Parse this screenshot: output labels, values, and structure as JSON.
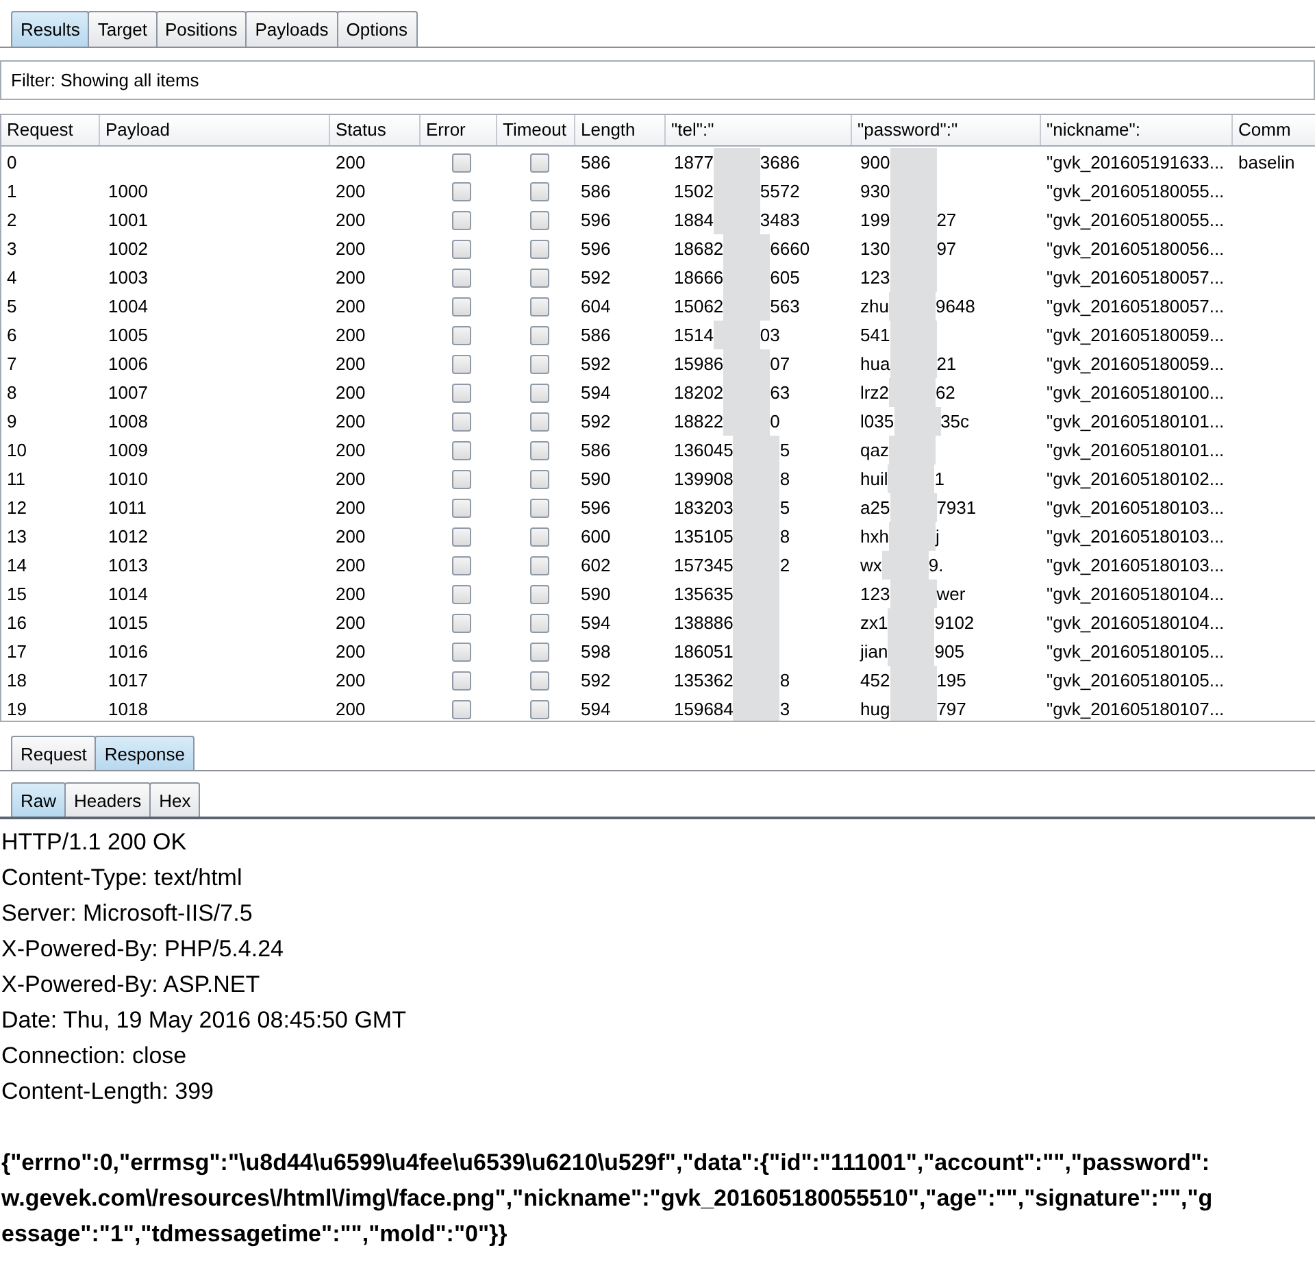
{
  "tabs": [
    {
      "label": "Results",
      "selected": true
    },
    {
      "label": "Target",
      "selected": false
    },
    {
      "label": "Positions",
      "selected": false
    },
    {
      "label": "Payloads",
      "selected": false
    },
    {
      "label": "Options",
      "selected": false
    }
  ],
  "filter": "Filter: Showing all items",
  "table": {
    "columns": [
      "Request",
      "Payload",
      "Status",
      "Error",
      "Timeout",
      "Length",
      "\"tel\":\"",
      "\"password\":\"",
      "\"nickname\":",
      "Comm"
    ],
    "rows": [
      {
        "request": "0",
        "status": "200",
        "error": false,
        "timeout": false,
        "length": "586",
        "tel": {
          "start": "1877",
          "end": "3686"
        },
        "password": {
          "start": "900"
        },
        "nickname": "\"gvk_201605191633...",
        "comment": "baselin"
      },
      {
        "request": "1",
        "payload": "1000",
        "status": "200",
        "error": false,
        "timeout": false,
        "length": "586",
        "tel": {
          "start": "1502",
          "end": "5572"
        },
        "password": {
          "start": "930"
        },
        "nickname": "\"gvk_201605180055..."
      },
      {
        "request": "2",
        "payload": "1001",
        "status": "200",
        "error": false,
        "timeout": false,
        "length": "596",
        "tel": {
          "start": "1884",
          "end": "3483"
        },
        "password": {
          "start": "199",
          "end": "27"
        },
        "nickname": "\"gvk_201605180055..."
      },
      {
        "request": "3",
        "payload": "1002",
        "status": "200",
        "error": false,
        "timeout": false,
        "length": "596",
        "tel": {
          "start": "18682",
          "end": "6660"
        },
        "password": {
          "start": "130",
          "end": "97"
        },
        "nickname": "\"gvk_201605180056..."
      },
      {
        "request": "4",
        "payload": "1003",
        "status": "200",
        "error": false,
        "timeout": false,
        "length": "592",
        "tel": {
          "start": "18666",
          "end": "605"
        },
        "password": {
          "start": "123"
        },
        "nickname": "\"gvk_201605180057..."
      },
      {
        "request": "5",
        "payload": "1004",
        "status": "200",
        "error": false,
        "timeout": false,
        "length": "604",
        "tel": {
          "start": "15062",
          "end": "563"
        },
        "password": {
          "start": "zhu",
          "end": "9648"
        },
        "nickname": "\"gvk_201605180057..."
      },
      {
        "request": "6",
        "payload": "1005",
        "status": "200",
        "error": false,
        "timeout": false,
        "length": "586",
        "tel": {
          "start": "1514",
          "end": "03"
        },
        "password": {
          "start": "541"
        },
        "nickname": "\"gvk_201605180059..."
      },
      {
        "request": "7",
        "payload": "1006",
        "status": "200",
        "error": false,
        "timeout": false,
        "length": "592",
        "tel": {
          "start": "15986",
          "end": "07"
        },
        "password": {
          "start": "hua",
          "end": "21"
        },
        "nickname": "\"gvk_201605180059..."
      },
      {
        "request": "8",
        "payload": "1007",
        "status": "200",
        "error": false,
        "timeout": false,
        "length": "594",
        "tel": {
          "start": "18202",
          "end": "63"
        },
        "password": {
          "start": "lrz2",
          "end": "62"
        },
        "nickname": "\"gvk_201605180100..."
      },
      {
        "request": "9",
        "payload": "1008",
        "status": "200",
        "error": false,
        "timeout": false,
        "length": "592",
        "tel": {
          "start": "18822",
          "end": "0"
        },
        "password": {
          "start": "l035",
          "end": "35c"
        },
        "nickname": "\"gvk_201605180101..."
      },
      {
        "request": "10",
        "payload": "1009",
        "status": "200",
        "error": false,
        "timeout": false,
        "length": "586",
        "tel": {
          "start": "136045",
          "end": "5"
        },
        "password": {
          "start": "qaz"
        },
        "nickname": "\"gvk_201605180101..."
      },
      {
        "request": "11",
        "payload": "1010",
        "status": "200",
        "error": false,
        "timeout": false,
        "length": "590",
        "tel": {
          "start": "139908",
          "end": "8"
        },
        "password": {
          "start": "huil",
          "end": "1"
        },
        "nickname": "\"gvk_201605180102..."
      },
      {
        "request": "12",
        "payload": "1011",
        "status": "200",
        "error": false,
        "timeout": false,
        "length": "596",
        "tel": {
          "start": "183203",
          "end": "5"
        },
        "password": {
          "start": "a25",
          "end": "7931"
        },
        "nickname": "\"gvk_201605180103..."
      },
      {
        "request": "13",
        "payload": "1012",
        "status": "200",
        "error": false,
        "timeout": false,
        "length": "600",
        "tel": {
          "start": "135105",
          "end": "8"
        },
        "password": {
          "start": "hxh",
          "end": "j"
        },
        "nickname": "\"gvk_201605180103..."
      },
      {
        "request": "14",
        "payload": "1013",
        "status": "200",
        "error": false,
        "timeout": false,
        "length": "602",
        "tel": {
          "start": "157345",
          "end": "2"
        },
        "password": {
          "start": "wx",
          "end": "9."
        },
        "nickname": "\"gvk_201605180103..."
      },
      {
        "request": "15",
        "payload": "1014",
        "status": "200",
        "error": false,
        "timeout": false,
        "length": "590",
        "tel": {
          "start": "135635"
        },
        "password": {
          "start": "123",
          "end": "wer"
        },
        "nickname": "\"gvk_201605180104..."
      },
      {
        "request": "16",
        "payload": "1015",
        "status": "200",
        "error": false,
        "timeout": false,
        "length": "594",
        "tel": {
          "start": "138886"
        },
        "password": {
          "start": "zx1",
          "end": "9102"
        },
        "nickname": "\"gvk_201605180104..."
      },
      {
        "request": "17",
        "payload": "1016",
        "status": "200",
        "error": false,
        "timeout": false,
        "length": "598",
        "tel": {
          "start": "186051"
        },
        "password": {
          "start": "jian",
          "end": "905"
        },
        "nickname": "\"gvk_201605180105..."
      },
      {
        "request": "18",
        "payload": "1017",
        "status": "200",
        "error": false,
        "timeout": false,
        "length": "592",
        "tel": {
          "start": "135362",
          "end": "8"
        },
        "password": {
          "start": "452",
          "end": "195"
        },
        "nickname": "\"gvk_201605180105..."
      },
      {
        "request": "19",
        "payload": "1018",
        "status": "200",
        "error": false,
        "timeout": false,
        "length": "594",
        "tel": {
          "start": "159684",
          "end": "3"
        },
        "password": {
          "start": "hug",
          "end": "797"
        },
        "nickname": "\"gvk_201605180107..."
      }
    ]
  },
  "message_tabs": [
    {
      "label": "Request",
      "selected": false
    },
    {
      "label": "Response",
      "selected": true
    }
  ],
  "view_tabs": [
    {
      "label": "Raw",
      "selected": true
    },
    {
      "label": "Headers",
      "selected": false
    },
    {
      "label": "Hex",
      "selected": false
    }
  ],
  "response_lines": [
    "HTTP/1.1 200 OK",
    "Content-Type: text/html",
    "Server: Microsoft-IIS/7.5",
    "X-Powered-By: PHP/5.4.24",
    "X-Powered-By: ASP.NET",
    "Date: Thu, 19 May 2016 08:45:50 GMT",
    "Connection: close",
    "Content-Length: 399"
  ],
  "response_body": [
    "{\"errno\":0,\"errmsg\":\"\\u8d44\\u6599\\u4fee\\u6539\\u6210\\u529f\",\"data\":{\"id\":\"111001\",\"account\":\"\",\"password\":",
    "w.gevek.com\\/resources\\/html\\/img\\/face.png\",\"nickname\":\"gvk_201605180055510\",\"age\":\"\",\"signature\":\"\",\"g",
    "essage\":\"1\",\"tdmessagetime\":\"\",\"mold\":\"0\"}}"
  ]
}
